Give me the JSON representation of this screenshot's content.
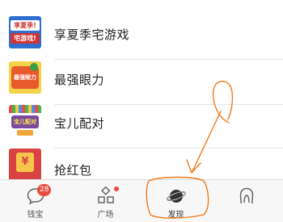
{
  "list": {
    "items": [
      {
        "label": "享夏季宅游戏",
        "thumb_text_1": "享夏季!",
        "thumb_text_2": "宅游戏!"
      },
      {
        "label": "最强眼力",
        "thumb_text_1": "最强眼力"
      },
      {
        "label": "宝儿配对",
        "thumb_text_1": "宝儿配对"
      },
      {
        "label": "抢红包",
        "thumb_text_1": "¥"
      }
    ]
  },
  "tabbar": {
    "tabs": [
      {
        "label": "钱宝",
        "icon": "chat-bubble-icon",
        "badge": "28"
      },
      {
        "label": "广场",
        "icon": "grid-squares-icon"
      },
      {
        "label": "发现",
        "icon": "planet-icon"
      },
      {
        "label": "",
        "icon": "profile-icon"
      }
    ]
  },
  "colors": {
    "badge": "#e84a3d",
    "annotation": "#f07a1c",
    "separator": "#e6e6e6"
  }
}
